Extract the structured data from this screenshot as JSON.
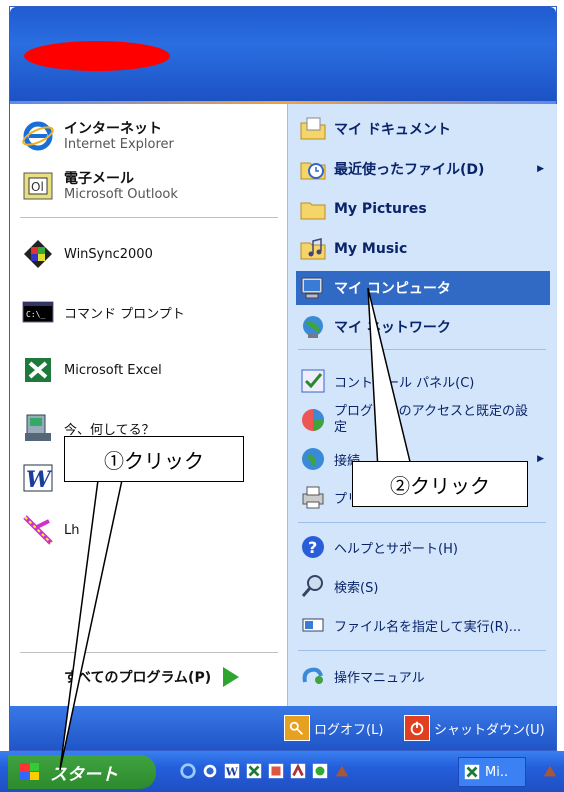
{
  "left_items": [
    {
      "title": "インターネット",
      "sub": "Internet Explorer",
      "icon": "internet-explorer-icon"
    },
    {
      "title": "電子メール",
      "sub": "Microsoft Outlook",
      "icon": "outlook-icon"
    },
    {
      "title": "WinSync2000",
      "icon": "winsync-icon"
    },
    {
      "title": "コマンド プロンプト",
      "icon": "command-prompt-icon"
    },
    {
      "title": "Microsoft Excel",
      "icon": "excel-icon"
    },
    {
      "title": "今、何してる？",
      "icon": "messenger-icon"
    },
    {
      "title": "Microsoft Word",
      "icon": "word-icon"
    },
    {
      "title": "Lh",
      "icon": "lhaplus-icon"
    }
  ],
  "all_programs": "すべてのプログラム(P)",
  "right_items": [
    {
      "label": "マイ ドキュメント",
      "icon": "my-documents-icon",
      "bold": true
    },
    {
      "label": "最近使ったファイル(D)",
      "icon": "recent-files-icon",
      "bold": true,
      "submenu": true
    },
    {
      "label": "My Pictures",
      "icon": "my-pictures-icon",
      "bold": true
    },
    {
      "label": "My Music",
      "icon": "my-music-icon",
      "bold": true
    },
    {
      "label": "マイ コンピュータ",
      "icon": "my-computer-icon",
      "bold": true,
      "selected": true
    },
    {
      "label": "マイ ネットワーク",
      "icon": "my-network-icon",
      "bold": true
    },
    {
      "label": "コントロール パネル(C)",
      "icon": "control-panel-icon"
    },
    {
      "label": "プログラムのアクセスと既定の設定",
      "icon": "program-access-icon"
    },
    {
      "label": "接続",
      "icon": "connect-icon",
      "submenu": true
    },
    {
      "label": "プリンタとFAX",
      "icon": "printer-icon"
    },
    {
      "label": "ヘルプとサポート(H)",
      "icon": "help-icon"
    },
    {
      "label": "検索(S)",
      "icon": "search-icon"
    },
    {
      "label": "ファイル名を指定して実行(R)...",
      "icon": "run-icon"
    },
    {
      "label": "操作マニュアル",
      "icon": "manual-icon"
    }
  ],
  "footer": {
    "logoff": "ログオフ(L)",
    "shutdown": "シャットダウン(U)"
  },
  "taskbar": {
    "start": "スタート",
    "task_label": "Mi.."
  },
  "callouts": {
    "one": "①クリック",
    "two": "②クリック"
  },
  "colors": {
    "selected": "#316ac5",
    "redacted": "#ff0000"
  }
}
